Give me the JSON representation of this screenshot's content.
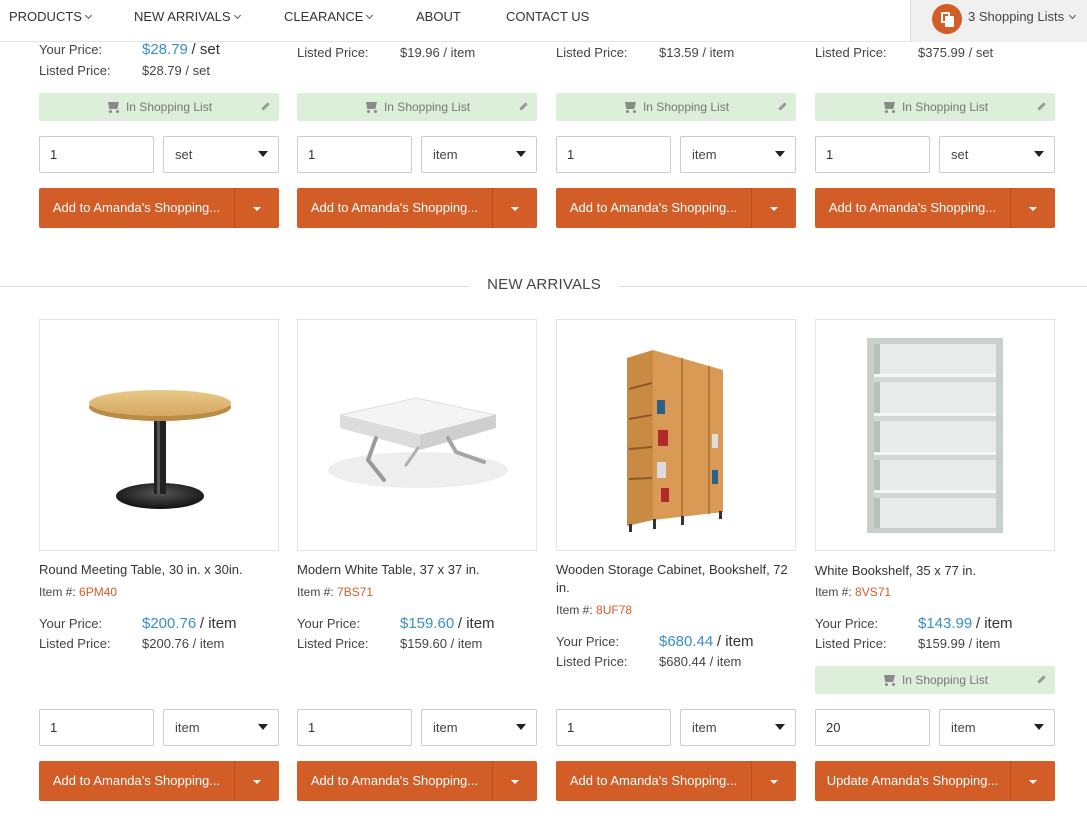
{
  "nav": {
    "items": [
      {
        "label": "PRODUCTS",
        "has_dropdown": true
      },
      {
        "label": "NEW ARRIVALS",
        "has_dropdown": true
      },
      {
        "label": "CLEARANCE",
        "has_dropdown": true
      },
      {
        "label": "ABOUT",
        "has_dropdown": false
      },
      {
        "label": "CONTACT US",
        "has_dropdown": false
      }
    ],
    "lists_label": "3 Shopping Lists"
  },
  "labels": {
    "your_price": "Your Price:",
    "listed_price": "Listed Price:",
    "in_shopping_list": "In Shopping List",
    "item_no": "Item #:"
  },
  "top_row": [
    {
      "your_price": "$28.79",
      "your_unit": "/ set",
      "listed_price": "$28.79 / set",
      "in_list": true,
      "qty": "1",
      "unit": "set",
      "button": "Add to Amanda's Shopping..."
    },
    {
      "listed_price": "$19.96 / item",
      "in_list": true,
      "qty": "1",
      "unit": "item",
      "button": "Add to Amanda's Shopping..."
    },
    {
      "listed_price": "$13.59 / item",
      "in_list": true,
      "qty": "1",
      "unit": "item",
      "button": "Add to Amanda's Shopping..."
    },
    {
      "listed_price": "$375.99 / set",
      "in_list": true,
      "qty": "1",
      "unit": "set",
      "button": "Add to Amanda's Shopping..."
    }
  ],
  "new_arrivals": {
    "title": "NEW ARRIVALS",
    "products": [
      {
        "name": "Round Meeting Table, 30 in. x 30in.",
        "item_code": "6PM40",
        "your_price": "$200.76",
        "your_unit": "/ item",
        "listed_price": "$200.76 / item",
        "in_list": false,
        "qty": "1",
        "unit": "item",
        "button": "Add to Amanda's Shopping...",
        "image": "round-table-image"
      },
      {
        "name": "Modern White Table, 37 x 37 in.",
        "item_code": "7BS71",
        "your_price": "$159.60",
        "your_unit": "/ item",
        "listed_price": "$159.60 / item",
        "in_list": false,
        "qty": "1",
        "unit": "item",
        "button": "Add to Amanda's Shopping...",
        "image": "white-table-image"
      },
      {
        "name": "Wooden Storage Cabinet, Bookshelf, 72 in.",
        "item_code": "8UF78",
        "your_price": "$680.44",
        "your_unit": "/ item",
        "listed_price": "$680.44 / item",
        "in_list": false,
        "qty": "1",
        "unit": "item",
        "button": "Add to Amanda's Shopping...",
        "image": "wooden-cabinet-image"
      },
      {
        "name": "White Bookshelf, 35 x 77 in.",
        "item_code": "8VS71",
        "your_price": "$143.99",
        "your_unit": "/ item",
        "listed_price": "$159.99 / item",
        "in_list": true,
        "qty": "20",
        "unit": "item",
        "button": "Update Amanda's Shopping...",
        "image": "white-bookshelf-image"
      }
    ]
  },
  "colors": {
    "accent": "#d35d27",
    "price_blue": "#3a8ec9",
    "in_list_bg": "#dcefd8"
  }
}
